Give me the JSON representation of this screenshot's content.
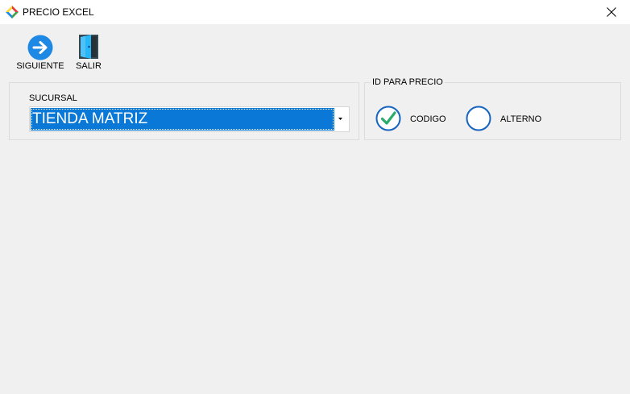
{
  "window": {
    "title": "PRECIO EXCEL"
  },
  "toolbar": {
    "siguiente_label": "SIGUIENTE",
    "salir_label": "SALIR"
  },
  "sucursal_group": {
    "label": "SUCURSAL",
    "selected_value": "TIENDA MATRIZ"
  },
  "id_group": {
    "legend": "ID PARA PRECIO",
    "options": [
      {
        "label": "CODIGO",
        "selected": true
      },
      {
        "label": "ALTERNO",
        "selected": false
      }
    ]
  },
  "colors": {
    "accent": "#0a78d7",
    "check": "#2bab6a",
    "window_bg": "#f0f0f0"
  },
  "icons": {
    "app": "app-logo-icon",
    "close": "close-icon",
    "siguiente": "arrow-right-circle-icon",
    "salir": "door-exit-icon",
    "dropdown": "dropdown-arrow-icon",
    "codigo": "check-circle-icon",
    "alterno": "empty-circle-icon"
  }
}
